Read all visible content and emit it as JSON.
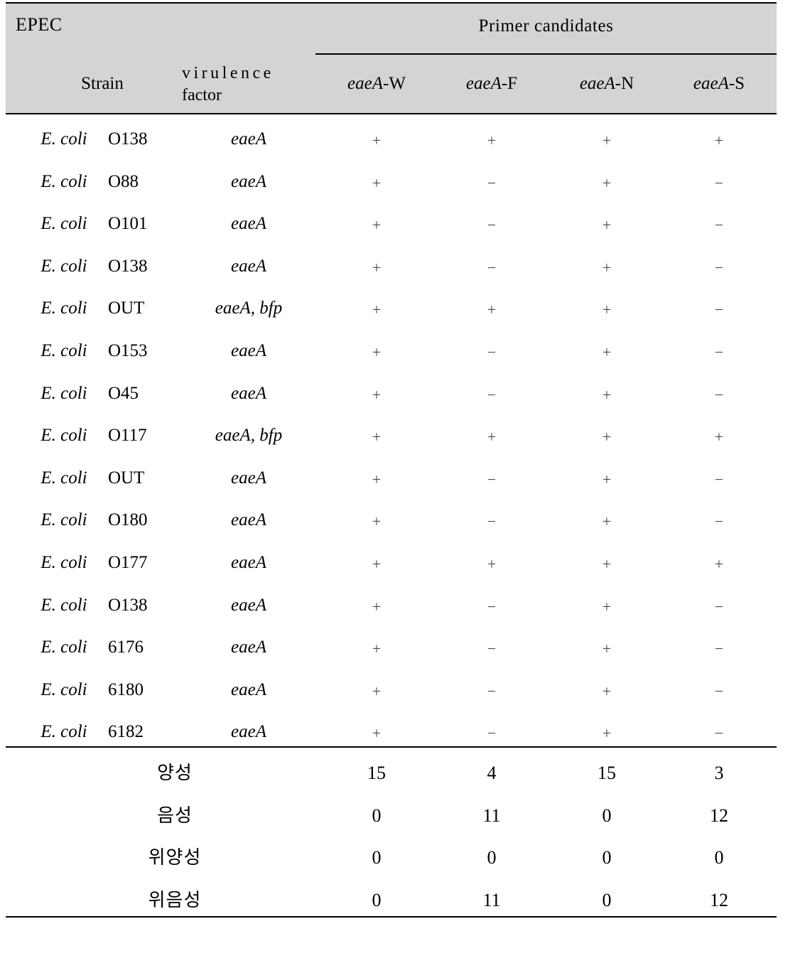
{
  "table": {
    "corner_label": "EPEC",
    "group_header": "Primer candidates",
    "col_strain": "Strain",
    "col_virulence_line1": "virulence",
    "col_virulence_line2": "factor",
    "primer_columns": [
      {
        "gene": "eaeA",
        "suffix": "-W"
      },
      {
        "gene": "eaeA",
        "suffix": "-F"
      },
      {
        "gene": "eaeA",
        "suffix": "-N"
      },
      {
        "gene": "eaeA",
        "suffix": "-S"
      }
    ],
    "header_background": "#d4d4d4",
    "rule_color": "#000000",
    "rows": [
      {
        "species": "E. coli",
        "strain": "O138",
        "virulence": "eaeA",
        "marks": [
          "+",
          "+",
          "+",
          "+"
        ]
      },
      {
        "species": "E. coli",
        "strain": "O88",
        "virulence": "eaeA",
        "marks": [
          "+",
          "−",
          "+",
          "−"
        ]
      },
      {
        "species": "E. coli",
        "strain": "O101",
        "virulence": "eaeA",
        "marks": [
          "+",
          "−",
          "+",
          "−"
        ]
      },
      {
        "species": "E. coli",
        "strain": "O138",
        "virulence": "eaeA",
        "marks": [
          "+",
          "−",
          "+",
          "−"
        ]
      },
      {
        "species": "E. coli",
        "strain": "OUT",
        "virulence": "eaeA, bfp",
        "marks": [
          "+",
          "+",
          "+",
          "−"
        ]
      },
      {
        "species": "E. coli",
        "strain": "O153",
        "virulence": "eaeA",
        "marks": [
          "+",
          "−",
          "+",
          "−"
        ]
      },
      {
        "species": "E. coli",
        "strain": "O45",
        "virulence": "eaeA",
        "marks": [
          "+",
          "−",
          "+",
          "−"
        ]
      },
      {
        "species": "E. coli",
        "strain": "O117",
        "virulence": "eaeA, bfp",
        "marks": [
          "+",
          "+",
          "+",
          "+"
        ]
      },
      {
        "species": "E. coli",
        "strain": "OUT",
        "virulence": "eaeA",
        "marks": [
          "+",
          "−",
          "+",
          "−"
        ]
      },
      {
        "species": "E. coli",
        "strain": "O180",
        "virulence": "eaeA",
        "marks": [
          "+",
          "−",
          "+",
          "−"
        ]
      },
      {
        "species": "E. coli",
        "strain": "O177",
        "virulence": "eaeA",
        "marks": [
          "+",
          "+",
          "+",
          "+"
        ]
      },
      {
        "species": "E. coli",
        "strain": "O138",
        "virulence": "eaeA",
        "marks": [
          "+",
          "−",
          "+",
          "−"
        ]
      },
      {
        "species": "E. coli",
        "strain": "6176",
        "virulence": "eaeA",
        "marks": [
          "+",
          "−",
          "+",
          "−"
        ]
      },
      {
        "species": "E. coli",
        "strain": "6180",
        "virulence": "eaeA",
        "marks": [
          "+",
          "−",
          "+",
          "−"
        ]
      },
      {
        "species": "E. coli",
        "strain": "6182",
        "virulence": "eaeA",
        "marks": [
          "+",
          "−",
          "+",
          "−"
        ]
      }
    ],
    "summary": [
      {
        "label": "양성",
        "values": [
          "15",
          "4",
          "15",
          "3"
        ]
      },
      {
        "label": "음성",
        "values": [
          "0",
          "11",
          "0",
          "12"
        ]
      },
      {
        "label": "위양성",
        "values": [
          "0",
          "0",
          "0",
          "0"
        ]
      },
      {
        "label": "위음성",
        "values": [
          "0",
          "11",
          "0",
          "12"
        ]
      }
    ]
  }
}
